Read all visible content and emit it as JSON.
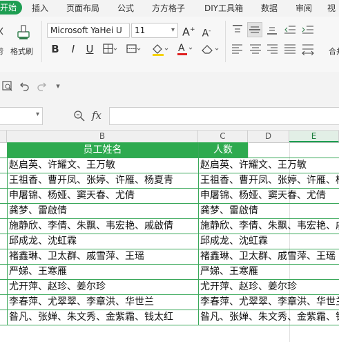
{
  "menu": {
    "active": "开始",
    "items": [
      "插入",
      "页面布局",
      "公式",
      "方方格子",
      "DIY工具箱",
      "数据",
      "审阅",
      "视"
    ]
  },
  "ribbon": {
    "cut_label": "剪切",
    "format_painter_label": "格式刷",
    "font_name": "Microsoft YaHei U",
    "font_size": "11",
    "merge_label": "合并"
  },
  "formula_bar": {
    "fx_label": "fx",
    "formula_value": ""
  },
  "columns": [
    "B",
    "C",
    "D",
    "E"
  ],
  "sheet": {
    "headers": {
      "B": "员工姓名",
      "C": "人数"
    },
    "rows": [
      {
        "b": "赵启英、许耀文、王万敏",
        "c": "赵启英、许耀文、王万敏"
      },
      {
        "b": "王祖香、曹开凤、张婷、许雁、杨夏青",
        "c": "王祖香、曹开凤、张婷、许雁、杨夏青"
      },
      {
        "b": "申屠锦、杨娅、窦天春、尤倩",
        "c": "申屠锦、杨娅、窦天春、尤倩"
      },
      {
        "b": "龚梦、雷啟倩",
        "c": "龚梦、雷啟倩"
      },
      {
        "b": "施静欣、李倩、朱飘、韦宏艳、戚啟倩",
        "c": "施静欣、李倩、朱飘、韦宏艳、戚啟倩"
      },
      {
        "b": "邱成龙、沈虹霖",
        "c": "邱成龙、沈虹霖"
      },
      {
        "b": "褚鑫琳、卫太群、戚雪萍、王瑶",
        "c": "褚鑫琳、卫太群、戚雪萍、王瑶"
      },
      {
        "b": "严娣、王寒雁",
        "c": "严娣、王寒雁"
      },
      {
        "b": "尤开萍、赵珍、姜尔珍",
        "c": "尤开萍、赵珍、姜尔珍"
      },
      {
        "b": "李春萍、尤翠翠、李章洪、华世兰",
        "c": "李春萍、尤翠翠、李章洪、华世兰"
      },
      {
        "b": "昝凡、张婵、朱文秀、金紫霜、钱太红",
        "c": "昝凡、张婵、朱文秀、金紫霜、钱太红"
      }
    ]
  },
  "colors": {
    "accent": "#1e9e52",
    "header_fill": "#2eaa4f",
    "grid_line": "#3aa85a"
  }
}
